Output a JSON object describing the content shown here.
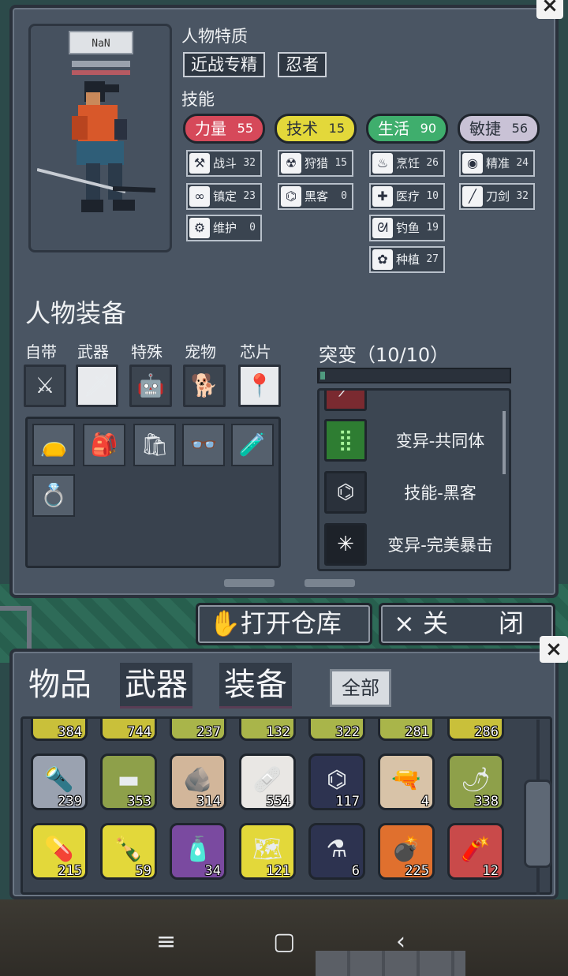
{
  "character": {
    "name": "NaN",
    "traits_label": "人物特质",
    "traits": [
      "近战专精",
      "忍者"
    ],
    "skills_label": "技能",
    "stats": [
      {
        "label": "力量",
        "value": "55",
        "color": "#d6495a"
      },
      {
        "label": "技术",
        "value": "15",
        "color": "#e3d83a"
      },
      {
        "label": "生活",
        "value": "90",
        "color": "#3fae6d"
      },
      {
        "label": "敏捷",
        "value": "56",
        "color": "#c9c2d6"
      }
    ],
    "skills": [
      {
        "label": "战斗",
        "value": "32",
        "icon": "wrench-icon"
      },
      {
        "label": "狩猎",
        "value": "15",
        "icon": "radiation-icon"
      },
      {
        "label": "烹饪",
        "value": "26",
        "icon": "pot-icon"
      },
      {
        "label": "精准",
        "value": "24",
        "icon": "eye-icon"
      },
      {
        "label": "镇定",
        "value": "23",
        "icon": "binoculars-icon"
      },
      {
        "label": "黑客",
        "value": "0",
        "icon": "circuit-icon"
      },
      {
        "label": "医疗",
        "value": "10",
        "icon": "medkit-icon"
      },
      {
        "label": "刀剑",
        "value": "32",
        "icon": "sword-icon"
      },
      {
        "label": "维护",
        "value": "0",
        "icon": "spanner-icon"
      },
      {
        "label": "钓鱼",
        "value": "19",
        "icon": "fish-icon"
      },
      {
        "label": "种植",
        "value": "27",
        "icon": "flower-icon"
      }
    ]
  },
  "equipment": {
    "title": "人物装备",
    "slot_labels": [
      "自带",
      "武器",
      "特殊",
      "宠物",
      "芯片"
    ],
    "slots": [
      {
        "icon": "claws-icon",
        "glyph": "⚔"
      },
      {
        "icon": "knives-icon",
        "glyph": "🗡"
      },
      {
        "icon": "robot-icon",
        "glyph": "🤖"
      },
      {
        "icon": "corgi-icon",
        "glyph": "🐕"
      },
      {
        "icon": "chip-icon",
        "glyph": "📍"
      }
    ],
    "bag": [
      {
        "icon": "pouch-icon",
        "glyph": "👝"
      },
      {
        "icon": "backpack-icon",
        "glyph": "🎒"
      },
      {
        "icon": "bag-icon",
        "glyph": "🛍"
      },
      {
        "icon": "goggles-icon",
        "glyph": "👓"
      },
      {
        "icon": "tank-icon",
        "glyph": "🧪"
      },
      {
        "icon": "ring-icon",
        "glyph": "💍"
      }
    ]
  },
  "mutations": {
    "title": "突变（10/10）",
    "progress": 0.02,
    "items": [
      {
        "label": "变异-共同体",
        "icon": "symbiosis-icon",
        "glyph": "⣿",
        "color": "#4caf50"
      },
      {
        "label": "技能-黑客",
        "icon": "circuit-icon",
        "glyph": "⌬",
        "color": "#2a313b"
      },
      {
        "label": "变异-完美暴击",
        "icon": "burst-icon",
        "glyph": "✳",
        "color": "#1d2229"
      }
    ]
  },
  "buttons": {
    "open_storage": "打开仓库",
    "close": "关　　闭",
    "close_x": "×"
  },
  "inventory": {
    "tabs": [
      "物品",
      "武器",
      "装备"
    ],
    "filter": "全部",
    "row_partial": [
      {
        "qty": "384",
        "color": "#c9c03a"
      },
      {
        "qty": "744",
        "color": "#c9c03a"
      },
      {
        "qty": "237",
        "color": "#a9b54a"
      },
      {
        "qty": "132",
        "color": "#a9b54a"
      },
      {
        "qty": "322",
        "color": "#a9b54a"
      },
      {
        "qty": "281",
        "color": "#a9b54a"
      },
      {
        "qty": "286",
        "color": "#c9c03a"
      }
    ],
    "row2": [
      {
        "qty": "239",
        "icon": "baton-icon",
        "glyph": "🔦",
        "color": "#9aa2b0"
      },
      {
        "qty": "353",
        "icon": "bullets-icon",
        "glyph": "▬",
        "color": "#8ea04a"
      },
      {
        "qty": "314",
        "icon": "stone-icon",
        "glyph": "🪨",
        "color": "#d2b69a"
      },
      {
        "qty": "554",
        "icon": "medkit-icon",
        "glyph": "🩹",
        "color": "#e9e7e4"
      },
      {
        "qty": "117",
        "icon": "chip-blueprint-icon",
        "glyph": "⌬",
        "color": "#2d3350"
      },
      {
        "qty": "4",
        "icon": "rifle-icon",
        "glyph": "🔫",
        "color": "#d8c3a8"
      },
      {
        "qty": "338",
        "icon": "pepper-icon",
        "glyph": "🌶",
        "color": "#8ea04a"
      }
    ],
    "row3": [
      {
        "qty": "215",
        "icon": "syringe-icon",
        "glyph": "💊",
        "color": "#e3d83a"
      },
      {
        "qty": "59",
        "icon": "bottle-icon",
        "glyph": "🍾",
        "color": "#e3d83a"
      },
      {
        "qty": "34",
        "icon": "canister-icon",
        "glyph": "🧴",
        "color": "#7a4aa0"
      },
      {
        "qty": "121",
        "icon": "map-icon",
        "glyph": "🗺",
        "color": "#e3d83a"
      },
      {
        "qty": "6",
        "icon": "flask-blueprint-icon",
        "glyph": "⚗",
        "color": "#2d3350"
      },
      {
        "qty": "225",
        "icon": "grenade-icon",
        "glyph": "💣",
        "color": "#e0702e"
      },
      {
        "qty": "12",
        "icon": "dynamite-icon",
        "glyph": "🧨",
        "color": "#c94a4a"
      }
    ]
  },
  "navbar": {
    "menu": "≡",
    "home": "▢",
    "back": "‹"
  }
}
